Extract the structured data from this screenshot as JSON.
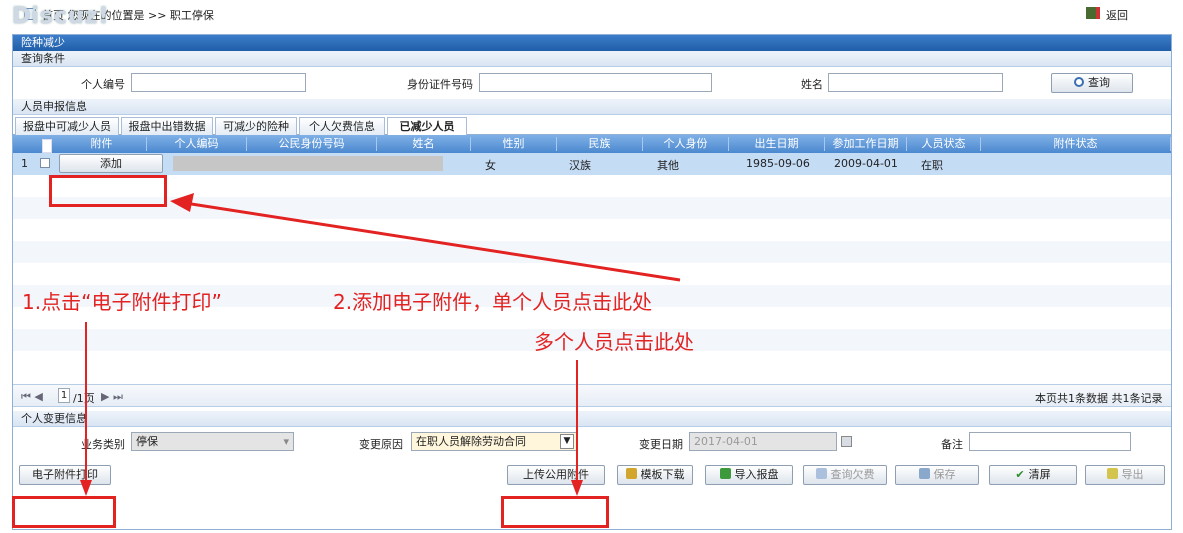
{
  "topbar": {
    "watermark": "Discuz!",
    "breadcrumb": "首页   您现在的位置是 >> 职工停保",
    "back_label": "返回"
  },
  "panel": {
    "title": "险种减少",
    "query_section": "查询条件",
    "query": {
      "person_id_label": "个人编号",
      "id_card_label": "身份证件号码",
      "name_label": "姓名",
      "search_button": "查询"
    },
    "report_section": "人员申报信息",
    "tabs": [
      "报盘中可减少人员",
      "报盘中出错数据",
      "可减少的险种",
      "个人欠费信息",
      "已减少人员"
    ],
    "active_tab": 4,
    "grid": {
      "columns": [
        "附件",
        "个人编码",
        "公民身份号码",
        "姓名",
        "性别",
        "民族",
        "个人身份",
        "出生日期",
        "参加工作日期",
        "人员状态",
        "附件状态"
      ],
      "rows": [
        {
          "index": "1",
          "attach_button": "添加",
          "gender": "女",
          "ethnicity": "汉族",
          "identity": "其他",
          "birth": "1985-09-06",
          "work_start": "2009-04-01",
          "status": "在职"
        }
      ]
    },
    "pager": {
      "nav_left": "⏮ ◀",
      "page": "1",
      "total_pages": "/1页",
      "nav_right": "▶ ⏭",
      "summary": "本页共1条数据 共1条记录"
    },
    "change_section": "个人变更信息",
    "change": {
      "business_type_label": "业务类别",
      "business_type_value": "停保",
      "reason_label": "变更原因",
      "reason_value": "在职人员解除劳动合同",
      "date_label": "变更日期",
      "date_value": "2017-04-01",
      "remark_label": "备注"
    },
    "buttons": {
      "print": "电子附件打印",
      "upload": "上传公用附件",
      "template": "模板下载",
      "import": "导入报盘",
      "query_arrears": "查询欠费",
      "save": "保存",
      "clear": "清屏",
      "export": "导出"
    }
  },
  "annotations": {
    "step1": "1.点击“电子附件打印”",
    "step2": "2.添加电子附件，单个人员点击此处",
    "step2b": "多个人员点击此处"
  },
  "colors": {
    "accent": "#1f5ea8",
    "annotation": "#e32222",
    "selected_row": "#c5dcf5"
  }
}
